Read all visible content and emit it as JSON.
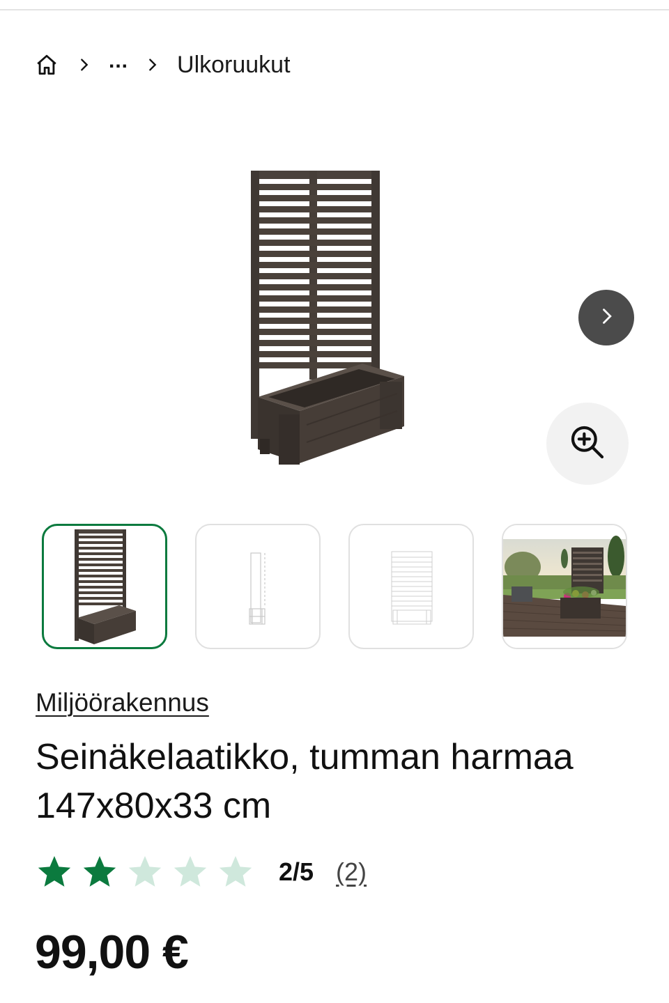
{
  "breadcrumb": {
    "home_icon": "home-icon",
    "separator_icon": "chevron-right-icon",
    "ellipsis": "...",
    "current": "Ulkoruukut"
  },
  "gallery": {
    "main_image": "wooden-planter-with-slatted-trellis",
    "next_icon": "chevron-right-icon",
    "zoom_icon": "zoom-in-icon",
    "thumbnails": [
      {
        "label": "planter-product-photo",
        "selected": true
      },
      {
        "label": "planter-side-dimension-drawing",
        "selected": false
      },
      {
        "label": "planter-front-dimension-drawing",
        "selected": false
      },
      {
        "label": "planter-on-terrace-lifestyle-photo",
        "selected": false
      }
    ]
  },
  "product": {
    "brand": "Miljöörakennus",
    "title": "Seinäkelaatikko, tumman harmaa 147x80x33 cm",
    "rating": {
      "score": 2,
      "max": 5,
      "score_text": "2/5",
      "count_text": "(2)"
    },
    "price": "99,00 €"
  },
  "colors": {
    "accent_green": "#0b7a3e",
    "star_filled": "#0b7a3e",
    "star_empty": "#cfe8dc",
    "wood_dark": "#3f3833",
    "button_dark": "#4b4b4b"
  }
}
